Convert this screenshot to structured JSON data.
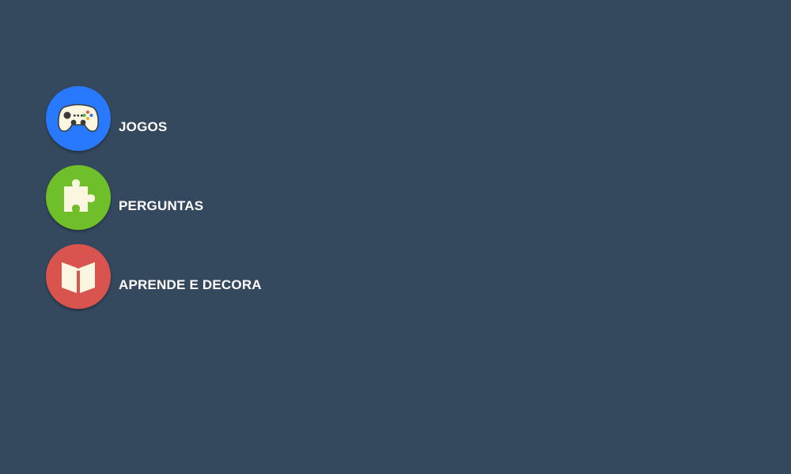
{
  "menu": {
    "items": [
      {
        "id": "jogos",
        "label": "JOGOS",
        "icon": "gamepad-icon",
        "color": "#2979ff"
      },
      {
        "id": "perguntas",
        "label": "PERGUNTAS",
        "icon": "puzzle-icon",
        "color": "#6fbf2a"
      },
      {
        "id": "aprende",
        "label": "APRENDE E DECORA",
        "icon": "book-icon",
        "color": "#d9534f"
      }
    ]
  },
  "colors": {
    "background": "#34495e",
    "text": "#ffffff"
  }
}
